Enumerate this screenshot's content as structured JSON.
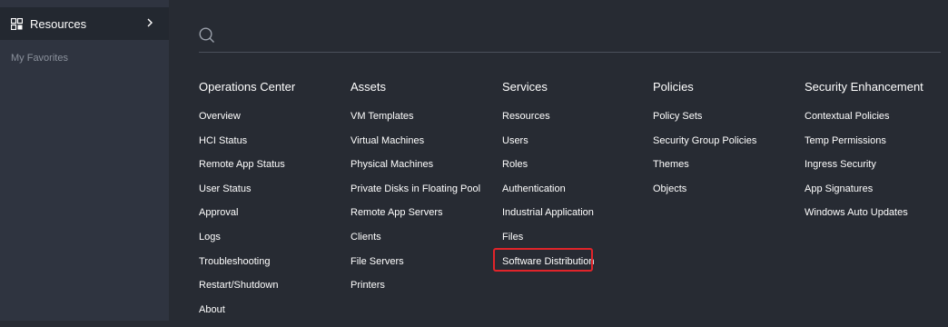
{
  "sidebar": {
    "resources_label": "Resources",
    "favorites_label": "My Favorites"
  },
  "search": {
    "placeholder": "",
    "value": ""
  },
  "columns": [
    {
      "title": "Operations Center",
      "items": [
        "Overview",
        "HCI Status",
        "Remote App Status",
        "User Status",
        "Approval",
        "Logs",
        "Troubleshooting",
        "Restart/Shutdown",
        "About"
      ]
    },
    {
      "title": "Assets",
      "items": [
        "VM Templates",
        "Virtual Machines",
        "Physical Machines",
        "Private Disks in Floating Pool",
        "Remote App Servers",
        "Clients",
        "File Servers",
        "Printers"
      ]
    },
    {
      "title": "Services",
      "items": [
        "Resources",
        "Users",
        "Roles",
        "Authentication",
        "Industrial Application",
        "Files",
        "Software Distribution"
      ]
    },
    {
      "title": "Policies",
      "items": [
        "Policy Sets",
        "Security Group Policies",
        "Themes",
        "Objects"
      ]
    },
    {
      "title": "Security Enhancement",
      "items": [
        "Contextual Policies",
        "Temp Permissions",
        "Ingress Security",
        "App Signatures",
        "Windows Auto Updates"
      ]
    }
  ],
  "highlight": {
    "column": 2,
    "item": 6,
    "color": "#e0242a"
  },
  "colors": {
    "background": "#272b33",
    "sidebar": "#2f3440",
    "sidebar_active": "#232830",
    "text": "#ffffff",
    "muted": "#8a909b"
  },
  "icons": {
    "resources": "grid-icon",
    "expand": "chevron-right-icon",
    "search": "search-icon"
  }
}
